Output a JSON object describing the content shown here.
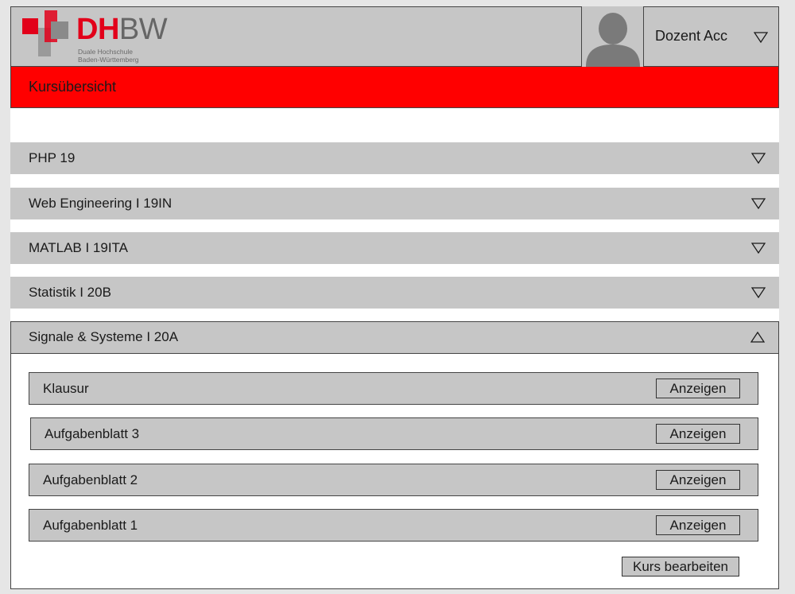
{
  "header": {
    "logo": {
      "brand_bold": "DH",
      "brand_light": "BW",
      "subtitle_line1": "Duale Hochschule",
      "subtitle_line2": "Baden-Württemberg"
    },
    "account_name": "Dozent Acc",
    "account_icon": "chevron-down-icon"
  },
  "page_title": "Kursübersicht",
  "courses": [
    {
      "label": "PHP 19",
      "state": "collapsed"
    },
    {
      "label": "Web Engineering I 19IN",
      "state": "collapsed"
    },
    {
      "label": "MATLAB I 19ITA",
      "state": "collapsed"
    },
    {
      "label": "Statistik I 20B",
      "state": "collapsed"
    },
    {
      "label": "Signale & Systeme I 20A",
      "state": "expanded"
    }
  ],
  "tasks": [
    {
      "label": "Klausur",
      "button": "Anzeigen"
    },
    {
      "label": "Aufgabenblatt 3",
      "button": "Anzeigen"
    },
    {
      "label": "Aufgabenblatt 2",
      "button": "Anzeigen"
    },
    {
      "label": "Aufgabenblatt 1",
      "button": "Anzeigen"
    }
  ],
  "edit_button": "Kurs bearbeiten",
  "colors": {
    "header_bg": "#c6c6c6",
    "title_bar": "#ff0000",
    "brand_red": "#e2001a",
    "avatar": "#7a7a7a"
  }
}
